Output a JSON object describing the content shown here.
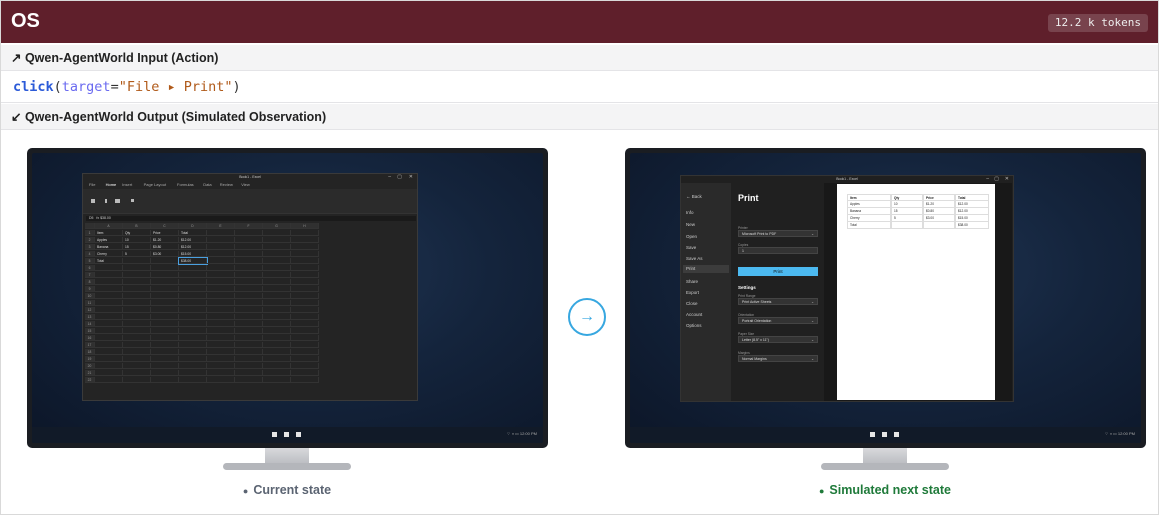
{
  "header": {
    "title": "OS",
    "tokens": "12.2 k tokens"
  },
  "input_section": {
    "label": "↗ Qwen-AgentWorld Input (Action)"
  },
  "action": {
    "fn": "click",
    "open": "(",
    "kw": "target",
    "eq": "=",
    "str": "\"File ▸ Print\"",
    "close": ")"
  },
  "output_section": {
    "label": "↙ Qwen-AgentWorld Output (Simulated Observation)"
  },
  "arrow_icon": "→",
  "left": {
    "caption": "Current state",
    "caption_color": "#5b6472",
    "window_title": "Book1 - Excel",
    "ribbon_tabs": [
      "File",
      "Home",
      "Insert",
      "Page Layout",
      "Formulas",
      "Data",
      "Review",
      "View"
    ],
    "name_box": "D5",
    "formula": "$38.00",
    "columns": [
      "",
      "A",
      "B",
      "C",
      "D",
      "E",
      "F",
      "G",
      "H"
    ],
    "rows": [
      [
        "1",
        "Item",
        "Qty",
        "Price",
        "Total"
      ],
      [
        "2",
        "Apples",
        "10",
        "$1.20",
        "$12.00"
      ],
      [
        "3",
        "Banana",
        "15",
        "$0.80",
        "$12.00"
      ],
      [
        "4",
        "Cherry",
        "5",
        "$3.00",
        "$15.00"
      ],
      [
        "5",
        "Total",
        "",
        "",
        "$38.00"
      ],
      [
        "6"
      ],
      [
        "7"
      ],
      [
        "8"
      ],
      [
        "9"
      ],
      [
        "10"
      ],
      [
        "11"
      ],
      [
        "12"
      ],
      [
        "13"
      ],
      [
        "14"
      ],
      [
        "15"
      ],
      [
        "16"
      ],
      [
        "17"
      ],
      [
        "18"
      ],
      [
        "19"
      ],
      [
        "20"
      ],
      [
        "21"
      ],
      [
        "22"
      ]
    ],
    "tray": "⌔ ◑ ▭  12:00 PM"
  },
  "right": {
    "caption": "Simulated next state",
    "caption_color": "#1f7a3a",
    "window_title": "Book1 - Excel",
    "nav": [
      "← Back",
      "Info",
      "New",
      "Open",
      "Save",
      "Save As",
      "Print",
      "Share",
      "Export",
      "Close",
      "Account",
      "Options"
    ],
    "active_nav": "Print",
    "heading": "Print",
    "fields": [
      {
        "label": "Printer",
        "value": "Microsoft Print to PDF"
      },
      {
        "label": "Copies",
        "value": "1"
      }
    ],
    "print_button": "Print",
    "settings_heading": "Settings",
    "settings": [
      {
        "label": "Print Range",
        "value": "Print Active Sheets"
      },
      {
        "label": "Orientation",
        "value": "Portrait Orientation"
      },
      {
        "label": "Paper Size",
        "value": "Letter (8.5\" x 11\")"
      },
      {
        "label": "Margins",
        "value": "Normal Margins"
      }
    ],
    "preview_table": [
      [
        "Item",
        "Qty",
        "Price",
        "Total"
      ],
      [
        "Apples",
        "10",
        "$1.20",
        "$12.00"
      ],
      [
        "Banana",
        "15",
        "$0.80",
        "$12.00"
      ],
      [
        "Cherry",
        "5",
        "$3.00",
        "$15.00"
      ],
      [
        "Total",
        "",
        "",
        "$38.00"
      ]
    ],
    "tray": "⌔ ◑ ▭  12:00 PM"
  }
}
